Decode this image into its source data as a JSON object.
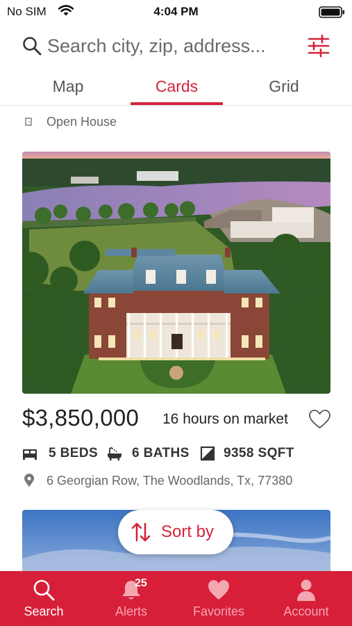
{
  "status_bar": {
    "carrier": "No SIM",
    "time": "4:04 PM"
  },
  "search": {
    "placeholder": "Search city, zip, address..."
  },
  "tabs": [
    {
      "label": "Map",
      "active": false
    },
    {
      "label": "Cards",
      "active": true
    },
    {
      "label": "Grid",
      "active": false
    }
  ],
  "filter": {
    "label": "Open House"
  },
  "listing": {
    "price": "$3,850,000",
    "market_time": "16 hours on market",
    "beds": "5 BEDS",
    "baths": "6 BATHS",
    "sqft": "9358 SQFT",
    "address": "6 Georgian Row, The Woodlands, Tx, 77380"
  },
  "sort_button": {
    "label": "Sort by"
  },
  "bottom_nav": {
    "items": [
      {
        "label": "Search",
        "icon": "search-icon",
        "active": true
      },
      {
        "label": "Alerts",
        "icon": "bell-icon",
        "badge": "25",
        "active": false
      },
      {
        "label": "Favorites",
        "icon": "heart-icon",
        "active": false
      },
      {
        "label": "Account",
        "icon": "person-icon",
        "active": false
      }
    ]
  },
  "colors": {
    "accent": "#d3243a",
    "tabbar": "#d81f3a",
    "text": "#222222",
    "muted": "#666666"
  }
}
